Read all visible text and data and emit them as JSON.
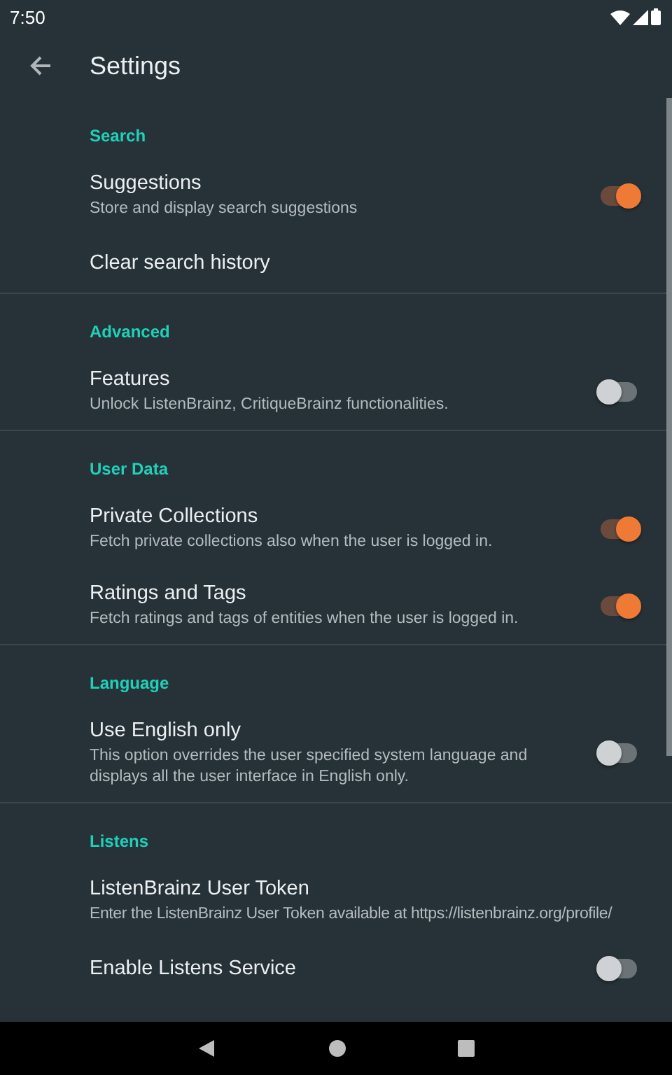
{
  "status_bar": {
    "time": "7:50"
  },
  "toolbar": {
    "title": "Settings"
  },
  "sections": [
    {
      "header": "Search",
      "items": [
        {
          "kind": "switch",
          "title": "Suggestions",
          "summary": "Store and display search suggestions",
          "on": true
        },
        {
          "kind": "text",
          "title": "Clear search history"
        }
      ]
    },
    {
      "header": "Advanced",
      "items": [
        {
          "kind": "switch",
          "title": "Features",
          "summary": "Unlock ListenBrainz, CritiqueBrainz functionalities.",
          "on": false
        }
      ]
    },
    {
      "header": "User Data",
      "items": [
        {
          "kind": "switch",
          "title": "Private Collections",
          "summary": "Fetch private collections also when the user is logged in.",
          "on": true
        },
        {
          "kind": "switch",
          "title": "Ratings and Tags",
          "summary": "Fetch ratings and tags of entities when the user is logged in.",
          "on": true
        }
      ]
    },
    {
      "header": "Language",
      "items": [
        {
          "kind": "switch",
          "title": "Use English only",
          "summary": "This option overrides the user specified system language and displays all the user interface in English only.",
          "on": false
        }
      ]
    },
    {
      "header": "Listens",
      "items": [
        {
          "kind": "text",
          "title": "ListenBrainz User Token",
          "summary": "Enter the ListenBrainz User Token available at https://listenbrainz.org/profile/"
        },
        {
          "kind": "switch",
          "title": "Enable Listens Service",
          "on": false
        }
      ]
    }
  ]
}
